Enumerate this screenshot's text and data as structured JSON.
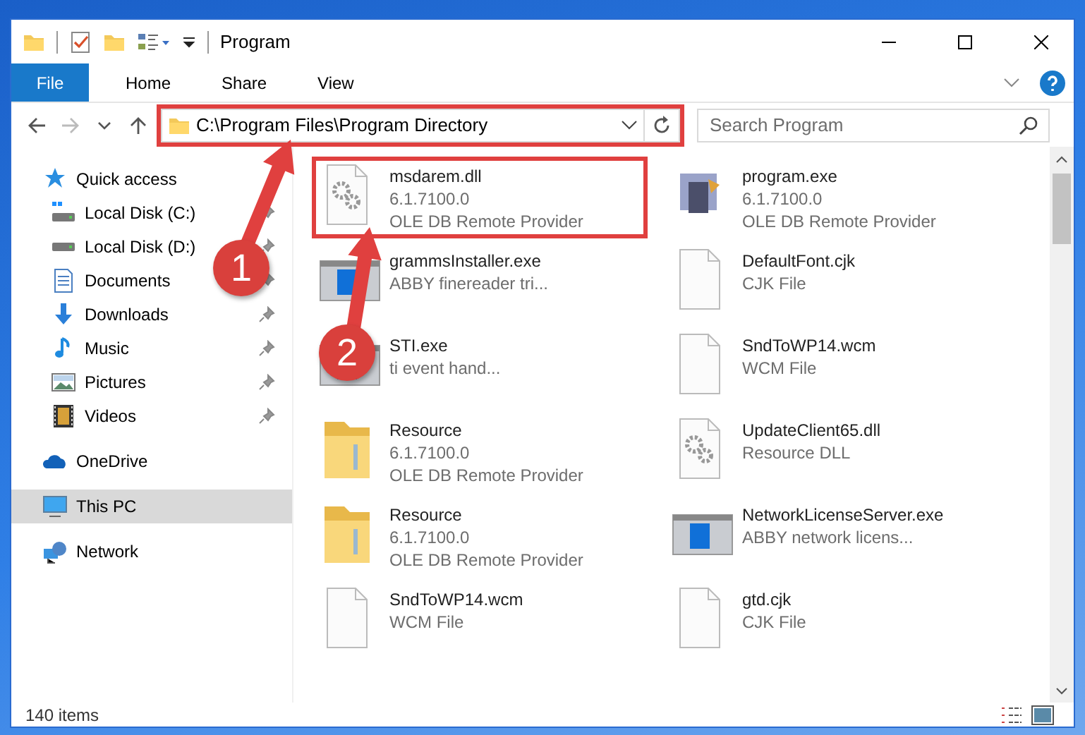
{
  "window": {
    "title": "Program"
  },
  "ribbon_tabs": [
    {
      "label": "File",
      "kind": "file"
    },
    {
      "label": "Home",
      "kind": "tab"
    },
    {
      "label": "Share",
      "kind": "tab"
    },
    {
      "label": "View",
      "kind": "tab"
    }
  ],
  "address_bar": {
    "path": "C:\\Program Files\\Program Directory",
    "highlighted": true
  },
  "search": {
    "placeholder": "Search Program"
  },
  "sidebar": {
    "items": [
      {
        "label": "Quick access",
        "kind": "star",
        "selected": false,
        "pinned": false,
        "children": [
          {
            "label": "Local Disk (C:)",
            "kind": "windrive",
            "selected": false,
            "pinned": true
          },
          {
            "label": "Local Disk (D:)",
            "kind": "drive",
            "selected": false,
            "pinned": true
          },
          {
            "label": "Documents",
            "kind": "document",
            "selected": false,
            "pinned": true
          },
          {
            "label": "Downloads",
            "kind": "download",
            "selected": false,
            "pinned": true
          },
          {
            "label": "Music",
            "kind": "music",
            "selected": false,
            "pinned": true
          },
          {
            "label": "Pictures",
            "kind": "picture",
            "selected": false,
            "pinned": true
          },
          {
            "label": "Videos",
            "kind": "video",
            "selected": false,
            "pinned": true
          }
        ]
      },
      {
        "label": "OneDrive",
        "kind": "cloud",
        "selected": false,
        "pinned": false
      },
      {
        "label": "This PC",
        "kind": "pc",
        "selected": true,
        "pinned": false
      },
      {
        "label": "Network",
        "kind": "network",
        "selected": false,
        "pinned": false
      }
    ]
  },
  "files": [
    {
      "name": "msdarem.dll",
      "lines": [
        "6.1.7100.0",
        "OLE DB Remote Provider"
      ],
      "kind": "gear",
      "highlighted": true
    },
    {
      "name": "program.exe",
      "lines": [
        "6.1.7100.0",
        "OLE DB Remote Provider"
      ],
      "kind": "setup",
      "highlighted": false
    },
    {
      "name": "grammsInstaller.exe",
      "lines": [
        "ABBY finereader tri..."
      ],
      "kind": "app",
      "highlighted": false
    },
    {
      "name": "DefaultFont.cjk",
      "lines": [
        "CJK File"
      ],
      "kind": "blank",
      "highlighted": false
    },
    {
      "name": "STI.exe",
      "lines": [
        "ti event hand..."
      ],
      "kind": "app",
      "highlighted": false
    },
    {
      "name": "SndToWP14.wcm",
      "lines": [
        "WCM File"
      ],
      "kind": "blank",
      "highlighted": false
    },
    {
      "name": "Resource",
      "lines": [
        "6.1.7100.0",
        "OLE DB Remote Provider"
      ],
      "kind": "folder",
      "highlighted": false
    },
    {
      "name": "UpdateClient65.dll",
      "lines": [
        "Resource DLL"
      ],
      "kind": "gear",
      "highlighted": false
    },
    {
      "name": "Resource",
      "lines": [
        "6.1.7100.0",
        "OLE DB Remote Provider"
      ],
      "kind": "folder",
      "highlighted": false
    },
    {
      "name": "NetworkLicenseServer.exe",
      "lines": [
        "ABBY network licens..."
      ],
      "kind": "app",
      "highlighted": false
    },
    {
      "name": "SndToWP14.wcm",
      "lines": [
        "WCM File"
      ],
      "kind": "blank",
      "highlighted": false
    },
    {
      "name": "gtd.cjk",
      "lines": [
        "CJK File"
      ],
      "kind": "blank",
      "highlighted": false
    }
  ],
  "status_bar": {
    "count": "140 items"
  },
  "callouts": [
    {
      "number": "1"
    },
    {
      "number": "2"
    }
  ]
}
